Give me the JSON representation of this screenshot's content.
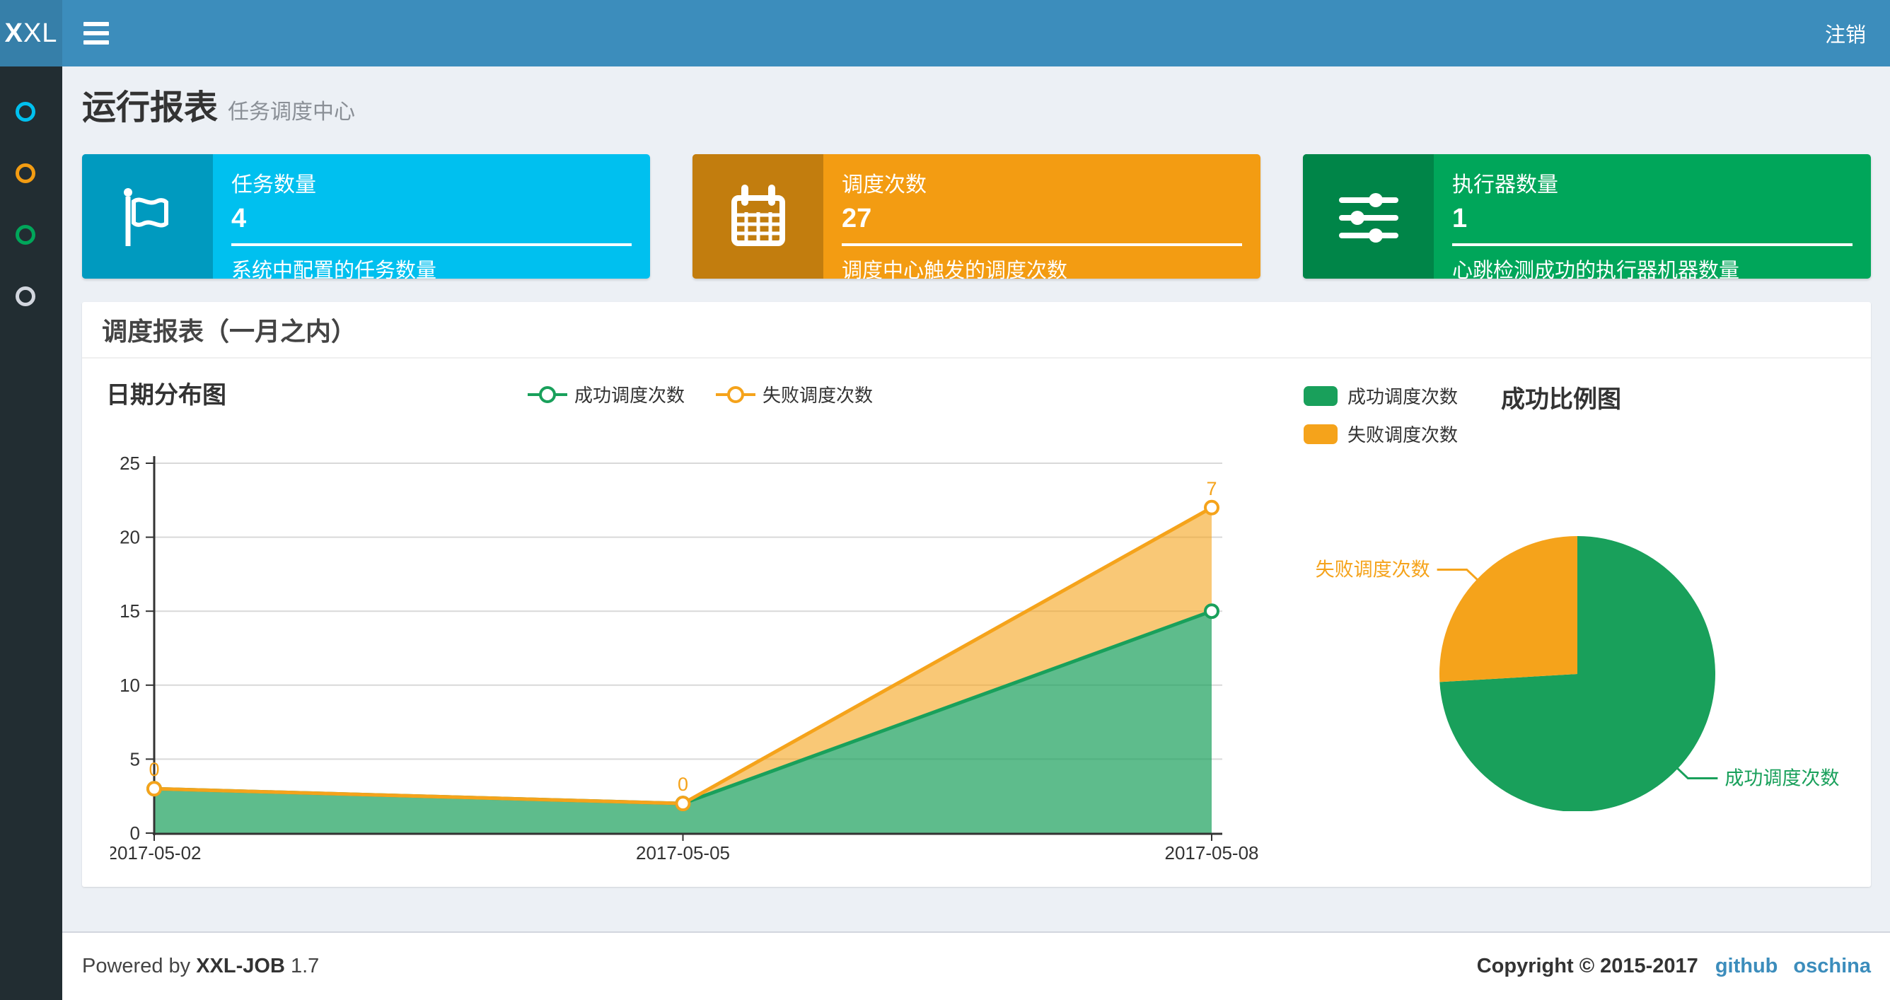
{
  "topbar": {
    "logo_bold": "X",
    "logo_rest": "XL",
    "logout": "注销"
  },
  "sidebar": {
    "items": [
      {
        "icon": "circle-icon",
        "color": "#00C0EF"
      },
      {
        "icon": "circle-icon",
        "color": "#F39C12"
      },
      {
        "icon": "circle-icon",
        "color": "#00A65A"
      },
      {
        "icon": "circle-icon",
        "color": "#D2D6DE"
      }
    ]
  },
  "page": {
    "title": "运行报表",
    "subtitle": "任务调度中心"
  },
  "stat_boxes": [
    {
      "title": "任务数量",
      "value": "4",
      "description": "系统中配置的任务数量",
      "color": "#00C0EF",
      "icon_bg": "#009ABF",
      "icon": "flag-icon"
    },
    {
      "title": "调度次数",
      "value": "27",
      "description": "调度中心触发的调度次数",
      "color": "#F39C12",
      "icon_bg": "#C27D0E",
      "icon": "calendar-icon"
    },
    {
      "title": "执行器数量",
      "value": "1",
      "description": "心跳检测成功的执行器机器数量",
      "color": "#00A65A",
      "icon_bg": "#008548",
      "icon": "sliders-icon"
    }
  ],
  "panel": {
    "title": "调度报表（一月之内）"
  },
  "chart_data": [
    {
      "type": "area",
      "title": "日期分布图",
      "stacked": true,
      "x": [
        "2017-05-02",
        "2017-05-05",
        "2017-05-08"
      ],
      "series": [
        {
          "name": "成功调度次数",
          "values": [
            3,
            2,
            15
          ],
          "color": "#19A05B",
          "fill": "rgba(25,160,91,0.70)"
        },
        {
          "name": "失败调度次数",
          "values": [
            0,
            0,
            7
          ],
          "color": "#F5A31B",
          "fill": "rgba(245,163,27,0.60)",
          "point_labels": [
            "0",
            "0",
            "7"
          ]
        }
      ],
      "ylim": [
        0,
        25
      ],
      "yticks": [
        0,
        5,
        10,
        15,
        20,
        25
      ],
      "grid": true,
      "legend_position": "top-center"
    },
    {
      "type": "pie",
      "title": "成功比例图",
      "slices": [
        {
          "name": "成功调度次数",
          "value": 20,
          "color": "#19A05B"
        },
        {
          "name": "失败调度次数",
          "value": 7,
          "color": "#F5A31B"
        }
      ],
      "legend_position": "top-left"
    }
  ],
  "footer": {
    "powered_prefix": "Powered by",
    "product": "XXL-JOB",
    "version": "1.7",
    "copyright": "Copyright © 2015-2017",
    "links": {
      "github": "github",
      "oschina": "oschina"
    }
  }
}
